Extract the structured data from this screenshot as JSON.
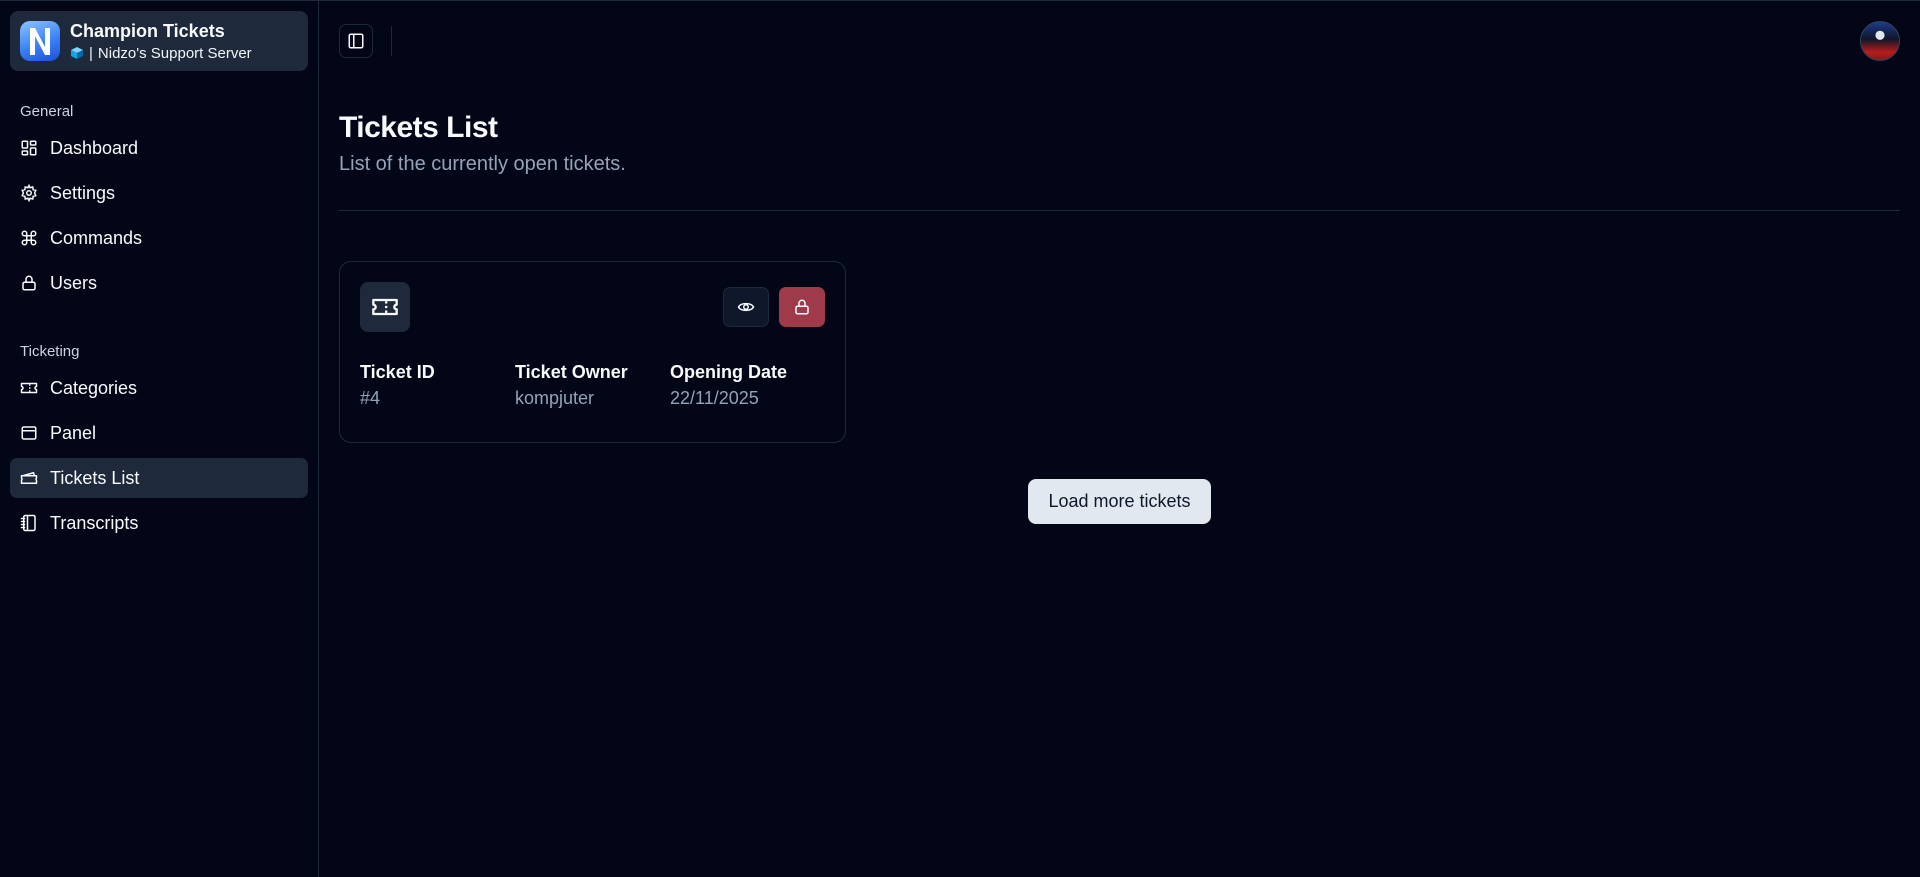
{
  "server": {
    "app_name": "Champion Tickets",
    "server_name": "Nidzo's Support Server",
    "separator": "|"
  },
  "sidebar": {
    "groups": [
      {
        "label": "General",
        "items": [
          {
            "label": "Dashboard",
            "icon": "dashboard-icon"
          },
          {
            "label": "Settings",
            "icon": "gear-icon"
          },
          {
            "label": "Commands",
            "icon": "command-icon"
          },
          {
            "label": "Users",
            "icon": "lock-icon"
          }
        ]
      },
      {
        "label": "Ticketing",
        "items": [
          {
            "label": "Categories",
            "icon": "ticket-icon"
          },
          {
            "label": "Panel",
            "icon": "panel-icon"
          },
          {
            "label": "Tickets List",
            "icon": "tickets-icon",
            "active": true
          },
          {
            "label": "Transcripts",
            "icon": "notebook-icon"
          }
        ]
      }
    ]
  },
  "page": {
    "title": "Tickets List",
    "subtitle": "List of the currently open tickets."
  },
  "tickets": [
    {
      "id_label": "Ticket ID",
      "id": "#4",
      "owner_label": "Ticket Owner",
      "owner": "kompjuter",
      "date_label": "Opening Date",
      "date": "22/11/2025"
    }
  ],
  "load_more_label": "Load more tickets",
  "colors": {
    "background": "#020617",
    "surface": "#1e293b",
    "muted_text": "#94a3b8",
    "close_button": "#9f3a4a",
    "load_more_bg": "#e2e8f0"
  }
}
